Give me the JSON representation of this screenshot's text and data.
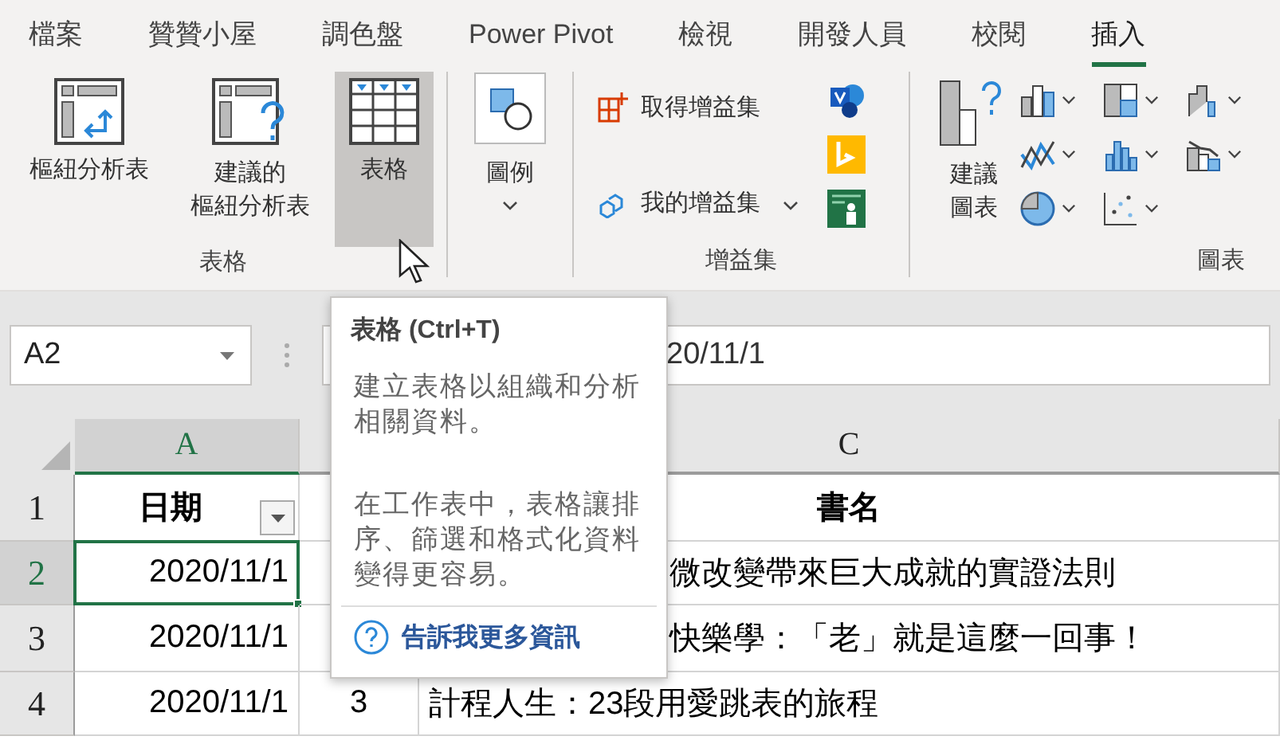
{
  "tabs": [
    {
      "label": "檔案",
      "selected": false
    },
    {
      "label": "贊贊小屋",
      "selected": false
    },
    {
      "label": "調色盤",
      "selected": false
    },
    {
      "label": "Power Pivot",
      "selected": false
    },
    {
      "label": "檢視",
      "selected": false
    },
    {
      "label": "開發人員",
      "selected": false
    },
    {
      "label": "校閱",
      "selected": false
    },
    {
      "label": "插入",
      "selected": true
    }
  ],
  "ribbon": {
    "tables_group": {
      "label": "表格",
      "buttons": [
        {
          "kind": "pivot",
          "label": "樞紐分析表",
          "hovered": false
        },
        {
          "kind": "suggested",
          "label_lines": [
            "建議的",
            "樞紐分析表"
          ],
          "hovered": false
        },
        {
          "kind": "table",
          "label": "表格",
          "hovered": true
        }
      ]
    },
    "illustrations": {
      "label": "圖例"
    },
    "addins_group": {
      "label": "增益集",
      "get": "取得增益集",
      "mine": "我的增益集"
    },
    "charts_group": {
      "label": "圖表",
      "recommended": "建議圖表"
    }
  },
  "formula_bar": {
    "name_box": "A2",
    "value": "20/11/1"
  },
  "columns": [
    {
      "label": "A",
      "selected": true
    },
    {
      "label": "C",
      "selected": false
    }
  ],
  "rows": [
    {
      "number": "1",
      "selected": false,
      "date": "日期",
      "title": "書名",
      "header": true
    },
    {
      "number": "2",
      "selected": true,
      "date": "2020/11/1",
      "title": "微改變帶來巨大成就的實證法則",
      "header": false
    },
    {
      "number": "3",
      "selected": false,
      "date": "2020/11/1",
      "title": "快樂學：「老」就是這麼一回事！",
      "header": false
    },
    {
      "number": "4",
      "selected": false,
      "date": "2020/11/1",
      "col_b": "3",
      "title": "計程人生：23段用愛跳表的旅程",
      "header": false
    }
  ],
  "tooltip": {
    "title": "表格 (Ctrl+T)",
    "paragraphs": [
      "建立表格以組織和分析相關資料。",
      "在工作表中，表格讓排序、篩選和格式化資料變得更容易。"
    ],
    "link": "告訴我更多資訊"
  }
}
